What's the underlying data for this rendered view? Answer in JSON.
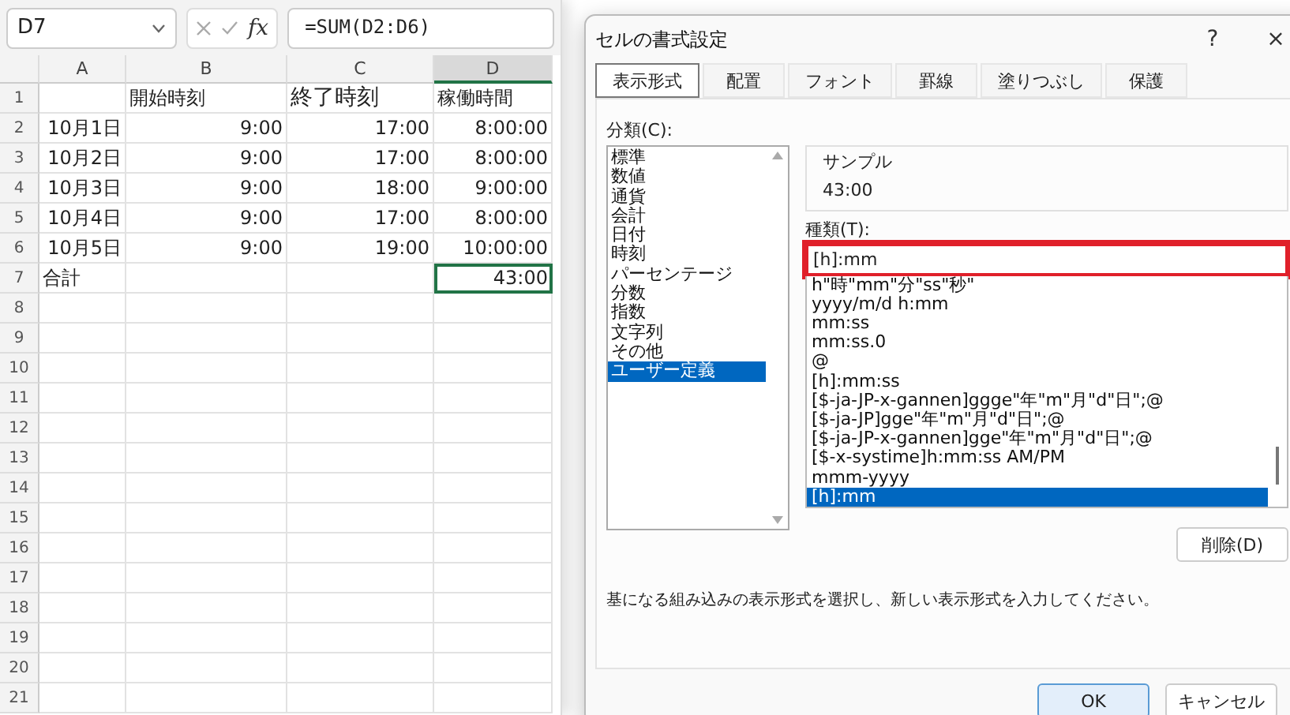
{
  "formula_bar": {
    "name_box": "D7",
    "function_label": "fx",
    "formula": "=SUM(D2:D6)"
  },
  "sheet": {
    "columns": [
      {
        "label": "A",
        "selected": false
      },
      {
        "label": "B",
        "selected": false
      },
      {
        "label": "C",
        "selected": false
      },
      {
        "label": "D",
        "selected": true
      }
    ],
    "rows": [
      {
        "number": "1",
        "cells": [
          "",
          "開始時刻",
          "終了時刻",
          "稼働時間"
        ]
      },
      {
        "number": "2",
        "cells": [
          "10月1日",
          "9:00",
          "17:00",
          "8:00:00"
        ]
      },
      {
        "number": "3",
        "cells": [
          "10月2日",
          "9:00",
          "17:00",
          "8:00:00"
        ]
      },
      {
        "number": "4",
        "cells": [
          "10月3日",
          "9:00",
          "18:00",
          "9:00:00"
        ]
      },
      {
        "number": "5",
        "cells": [
          "10月4日",
          "9:00",
          "17:00",
          "8:00:00"
        ]
      },
      {
        "number": "6",
        "cells": [
          "10月5日",
          "9:00",
          "19:00",
          "10:00:00"
        ]
      },
      {
        "number": "7",
        "cells": [
          "合計",
          "",
          "",
          "43:00"
        ]
      },
      {
        "number": "8",
        "cells": []
      },
      {
        "number": "9",
        "cells": []
      },
      {
        "number": "10",
        "cells": []
      },
      {
        "number": "11",
        "cells": []
      },
      {
        "number": "12",
        "cells": []
      },
      {
        "number": "13",
        "cells": []
      },
      {
        "number": "14",
        "cells": []
      },
      {
        "number": "15",
        "cells": []
      },
      {
        "number": "16",
        "cells": []
      },
      {
        "number": "17",
        "cells": []
      },
      {
        "number": "18",
        "cells": []
      },
      {
        "number": "19",
        "cells": []
      },
      {
        "number": "20",
        "cells": []
      },
      {
        "number": "21",
        "cells": []
      }
    ]
  },
  "dialog": {
    "title": "セルの書式設定",
    "help": "?",
    "close": "×",
    "tabs": [
      {
        "label": "表示形式",
        "selected": true
      },
      {
        "label": "配置",
        "selected": false
      },
      {
        "label": "フォント",
        "selected": false
      },
      {
        "label": "罫線",
        "selected": false
      },
      {
        "label": "塗りつぶし",
        "selected": false
      },
      {
        "label": "保護",
        "selected": false
      }
    ],
    "category_label": "分類(C):",
    "categories": [
      {
        "label": "標準",
        "selected": false
      },
      {
        "label": "数値",
        "selected": false
      },
      {
        "label": "通貨",
        "selected": false
      },
      {
        "label": "会計",
        "selected": false
      },
      {
        "label": "日付",
        "selected": false
      },
      {
        "label": "時刻",
        "selected": false
      },
      {
        "label": "パーセンテージ",
        "selected": false
      },
      {
        "label": "分数",
        "selected": false
      },
      {
        "label": "指数",
        "selected": false
      },
      {
        "label": "文字列",
        "selected": false
      },
      {
        "label": "その他",
        "selected": false
      },
      {
        "label": "ユーザー定義",
        "selected": true
      }
    ],
    "sample_label": "サンプル",
    "sample_value": "43:00",
    "type_label": "種類(T):",
    "type_value": "[h]:mm",
    "type_highlighted": true,
    "formats": [
      {
        "label": "h\"時\"mm\"分\"ss\"秒\"",
        "selected": false
      },
      {
        "label": "yyyy/m/d h:mm",
        "selected": false
      },
      {
        "label": "mm:ss",
        "selected": false
      },
      {
        "label": "mm:ss.0",
        "selected": false
      },
      {
        "label": "@",
        "selected": false
      },
      {
        "label": "[h]:mm:ss",
        "selected": false
      },
      {
        "label": "[$-ja-JP-x-gannen]ggge\"年\"m\"月\"d\"日\";@",
        "selected": false
      },
      {
        "label": "[$-ja-JP]gge\"年\"m\"月\"d\"日\";@",
        "selected": false
      },
      {
        "label": "[$-ja-JP-x-gannen]gge\"年\"m\"月\"d\"日\";@",
        "selected": false
      },
      {
        "label": "[$-x-systime]h:mm:ss AM/PM",
        "selected": false
      },
      {
        "label": "mmm-yyyy",
        "selected": false
      },
      {
        "label": "[h]:mm",
        "selected": true
      }
    ],
    "delete_button": "削除(D)",
    "description": "基になる組み込みの表示形式を選択し、新しい表示形式を入力してください。",
    "ok_button": "OK",
    "cancel_button": "キャンセル"
  }
}
